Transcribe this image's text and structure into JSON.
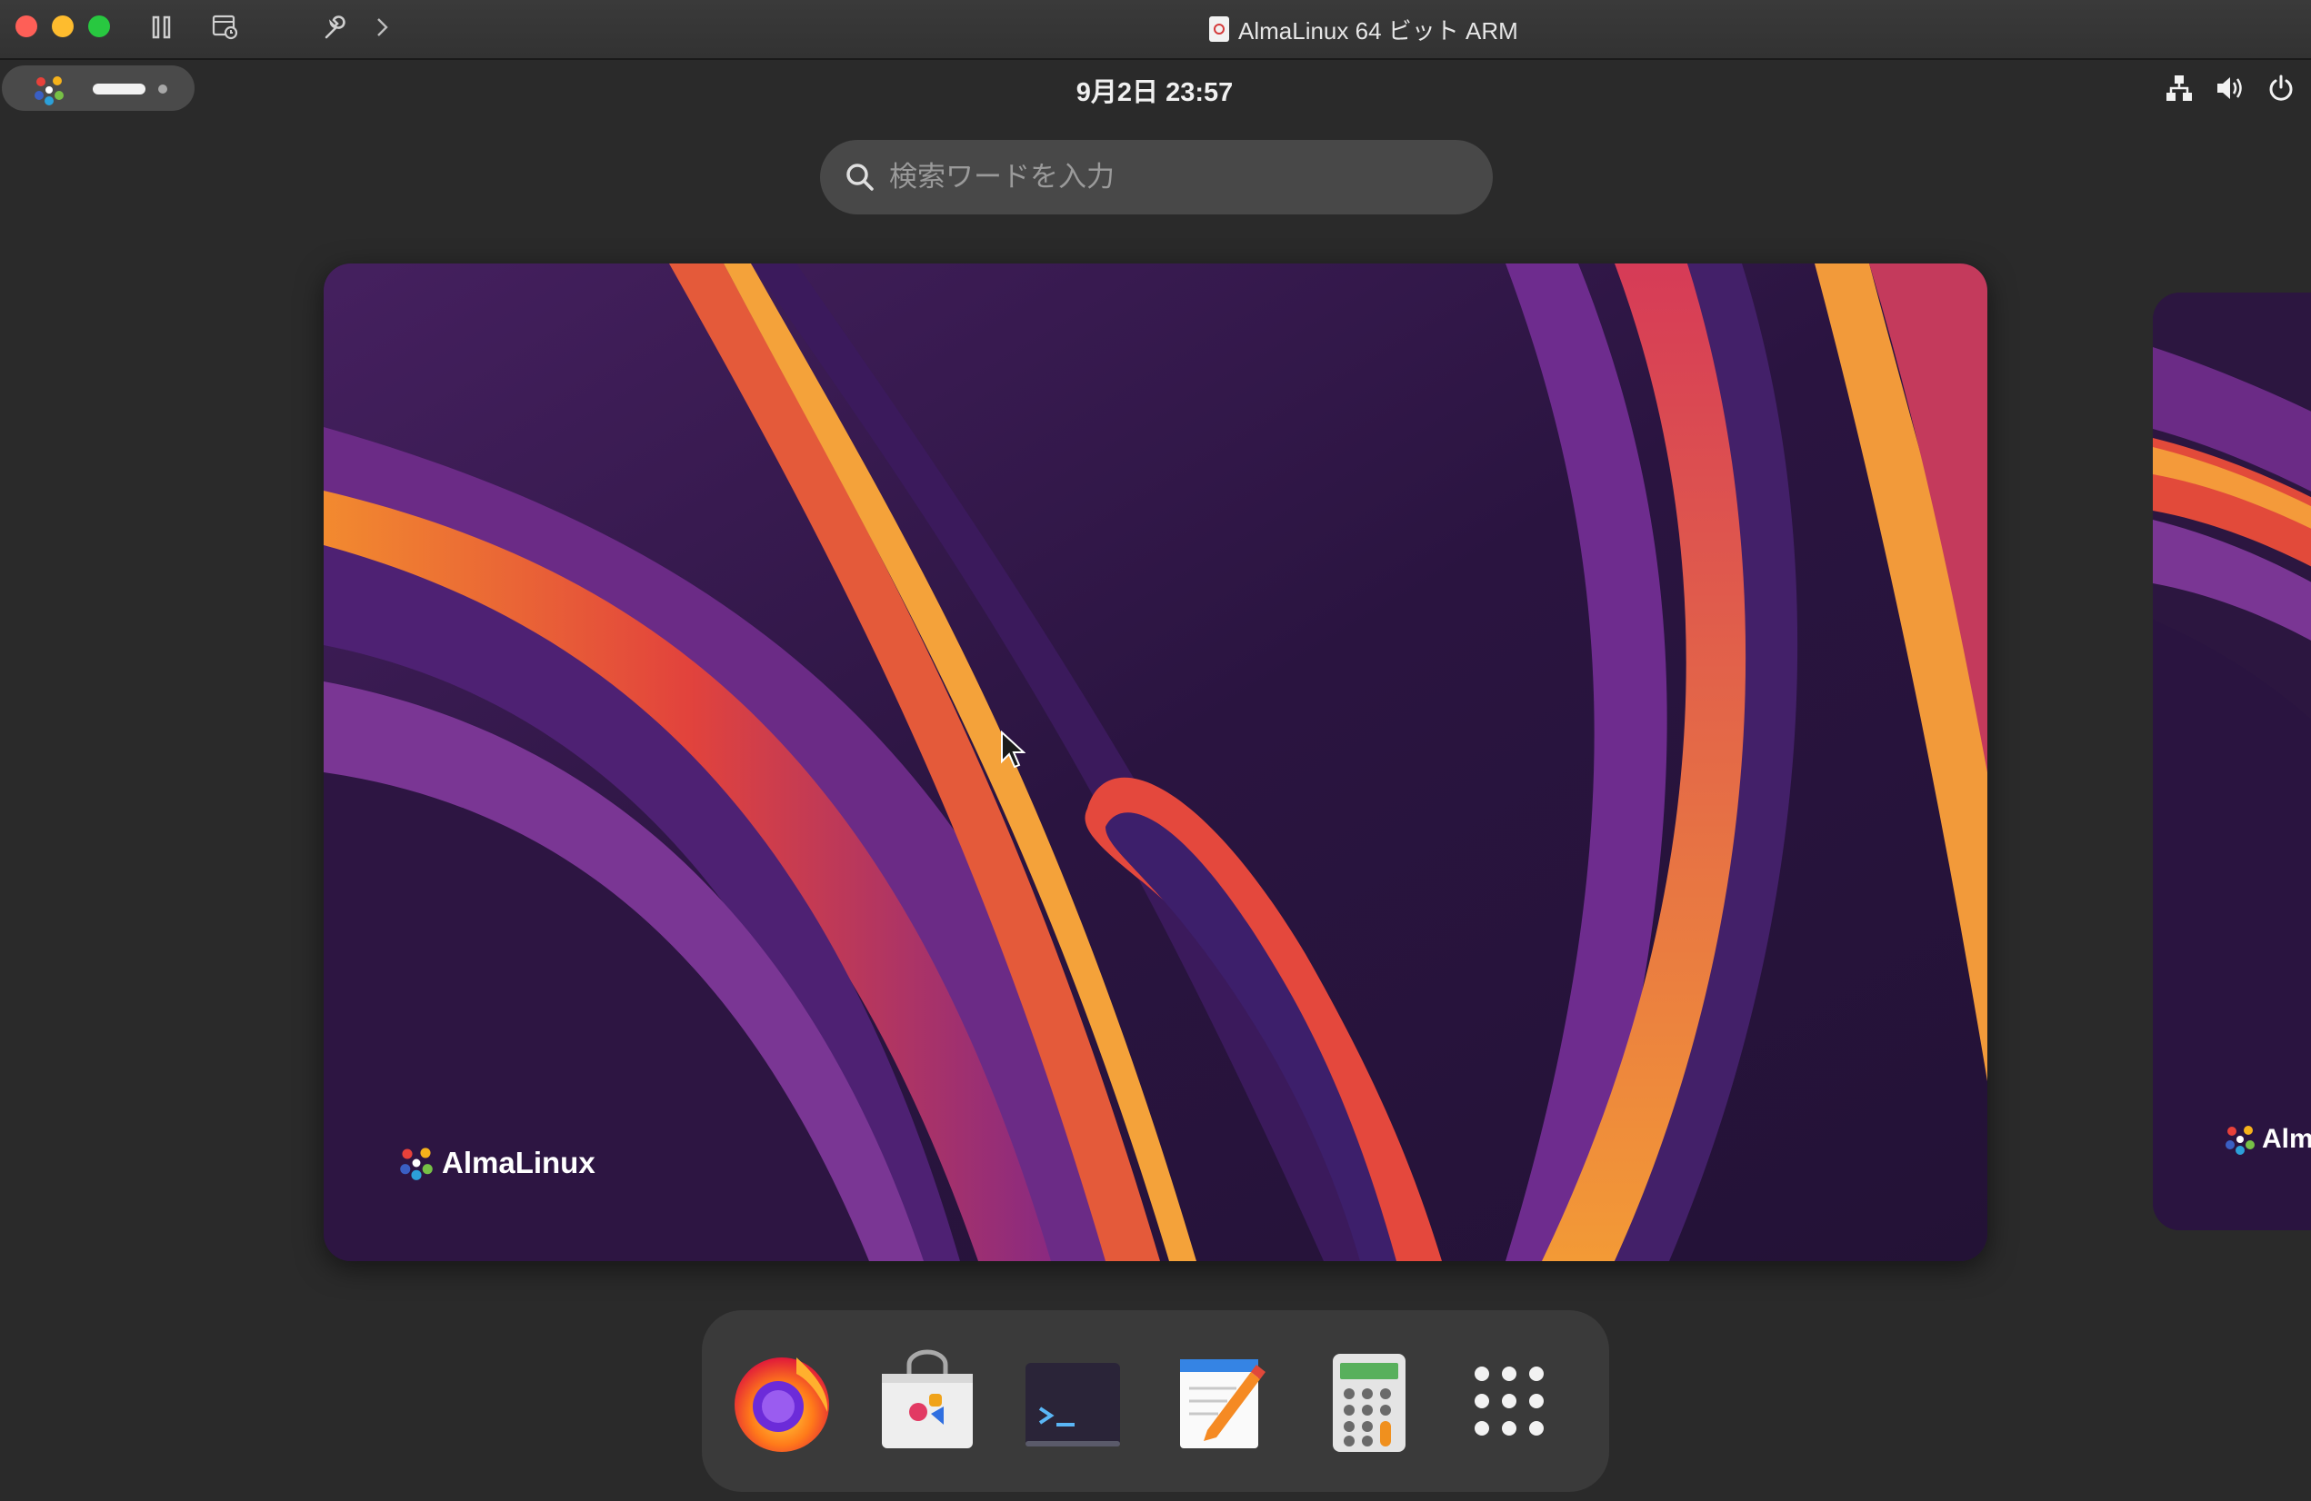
{
  "window": {
    "title": "AlmaLinux 64 ビット ARM"
  },
  "topbar": {
    "clock": "9月2日  23:57"
  },
  "search": {
    "placeholder": "検索ワードを入力"
  },
  "workspace": {
    "brand": "AlmaLinux",
    "next_brand": "Alm"
  },
  "dash": {
    "apps": [
      "Firefox",
      "Software",
      "Terminal",
      "Text Editor",
      "Calculator",
      "Show Applications"
    ]
  },
  "icons": {
    "toolbar": [
      "pause-icon",
      "snapshot-icon",
      "settings-wrench-icon",
      "forward-chevron-icon"
    ],
    "system": [
      "network-icon",
      "volume-icon",
      "power-icon"
    ]
  },
  "colors": {
    "wallpaper_base": "#2c1640",
    "accent_orange": "#f49a3a",
    "accent_red": "#e0413a",
    "accent_purple": "#6e2c8e"
  }
}
